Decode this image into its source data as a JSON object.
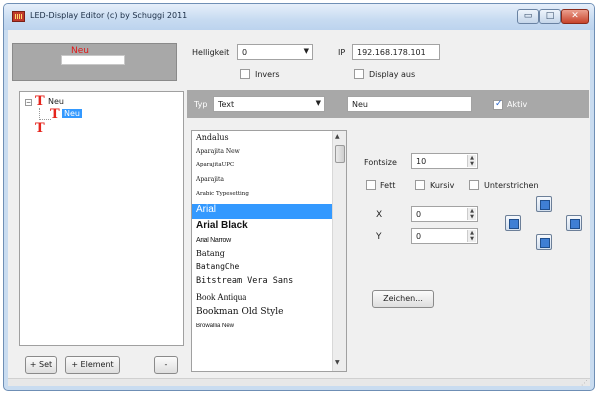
{
  "window": {
    "title": "LED-Display Editor  (c) by Schuggi 2011",
    "minimize_glyph": "▭",
    "maximize_glyph": "□",
    "close_glyph": "✕"
  },
  "preview": {
    "text": "Neu",
    "text_color": "#e01919"
  },
  "settings": {
    "helligkeit_label": "Helligkeit",
    "helligkeit_value": "0",
    "invers_label": "Invers",
    "ip_label": "IP",
    "ip_value": "192.168.178.101",
    "display_aus_label": "Display aus"
  },
  "tree": {
    "items": [
      {
        "label": "Neu",
        "icon": "t-icon"
      },
      {
        "label": "Neu",
        "icon": "t-icon",
        "selected": true
      },
      {
        "label": "",
        "icon": "t-icon"
      }
    ]
  },
  "element": {
    "typ_label": "Typ",
    "typ_value": "Text",
    "text_value": "Neu",
    "aktiv_label": "Aktiv",
    "aktiv_checked": true
  },
  "fonts": {
    "items": [
      "Andalus",
      "Aparajita New",
      "AparajitaUPC",
      "Aparajita",
      "Arabic Typesetting",
      "Arial",
      "Arial Black",
      "Arial Narrow",
      "Batang",
      "BatangChe",
      "Bitstream Vera Sans",
      "Book Antiqua",
      "Bookman Old Style",
      "Browallia New"
    ],
    "selected_index": 5
  },
  "format": {
    "fontsize_label": "Fontsize",
    "fontsize_value": "10",
    "fett_label": "Fett",
    "kursiv_label": "Kursiv",
    "unterstrichen_label": "Unterstrichen",
    "x_label": "X",
    "x_value": "0",
    "y_label": "Y",
    "y_value": "0",
    "zeichnen_label": "Zeichen..."
  },
  "buttons": {
    "add_set": "+ Set",
    "add_element": "+ Element",
    "remove": "-"
  },
  "colors": {
    "selection": "#3399ff",
    "accent_red": "#e5241c",
    "panel_gray": "#a8a8a8"
  }
}
